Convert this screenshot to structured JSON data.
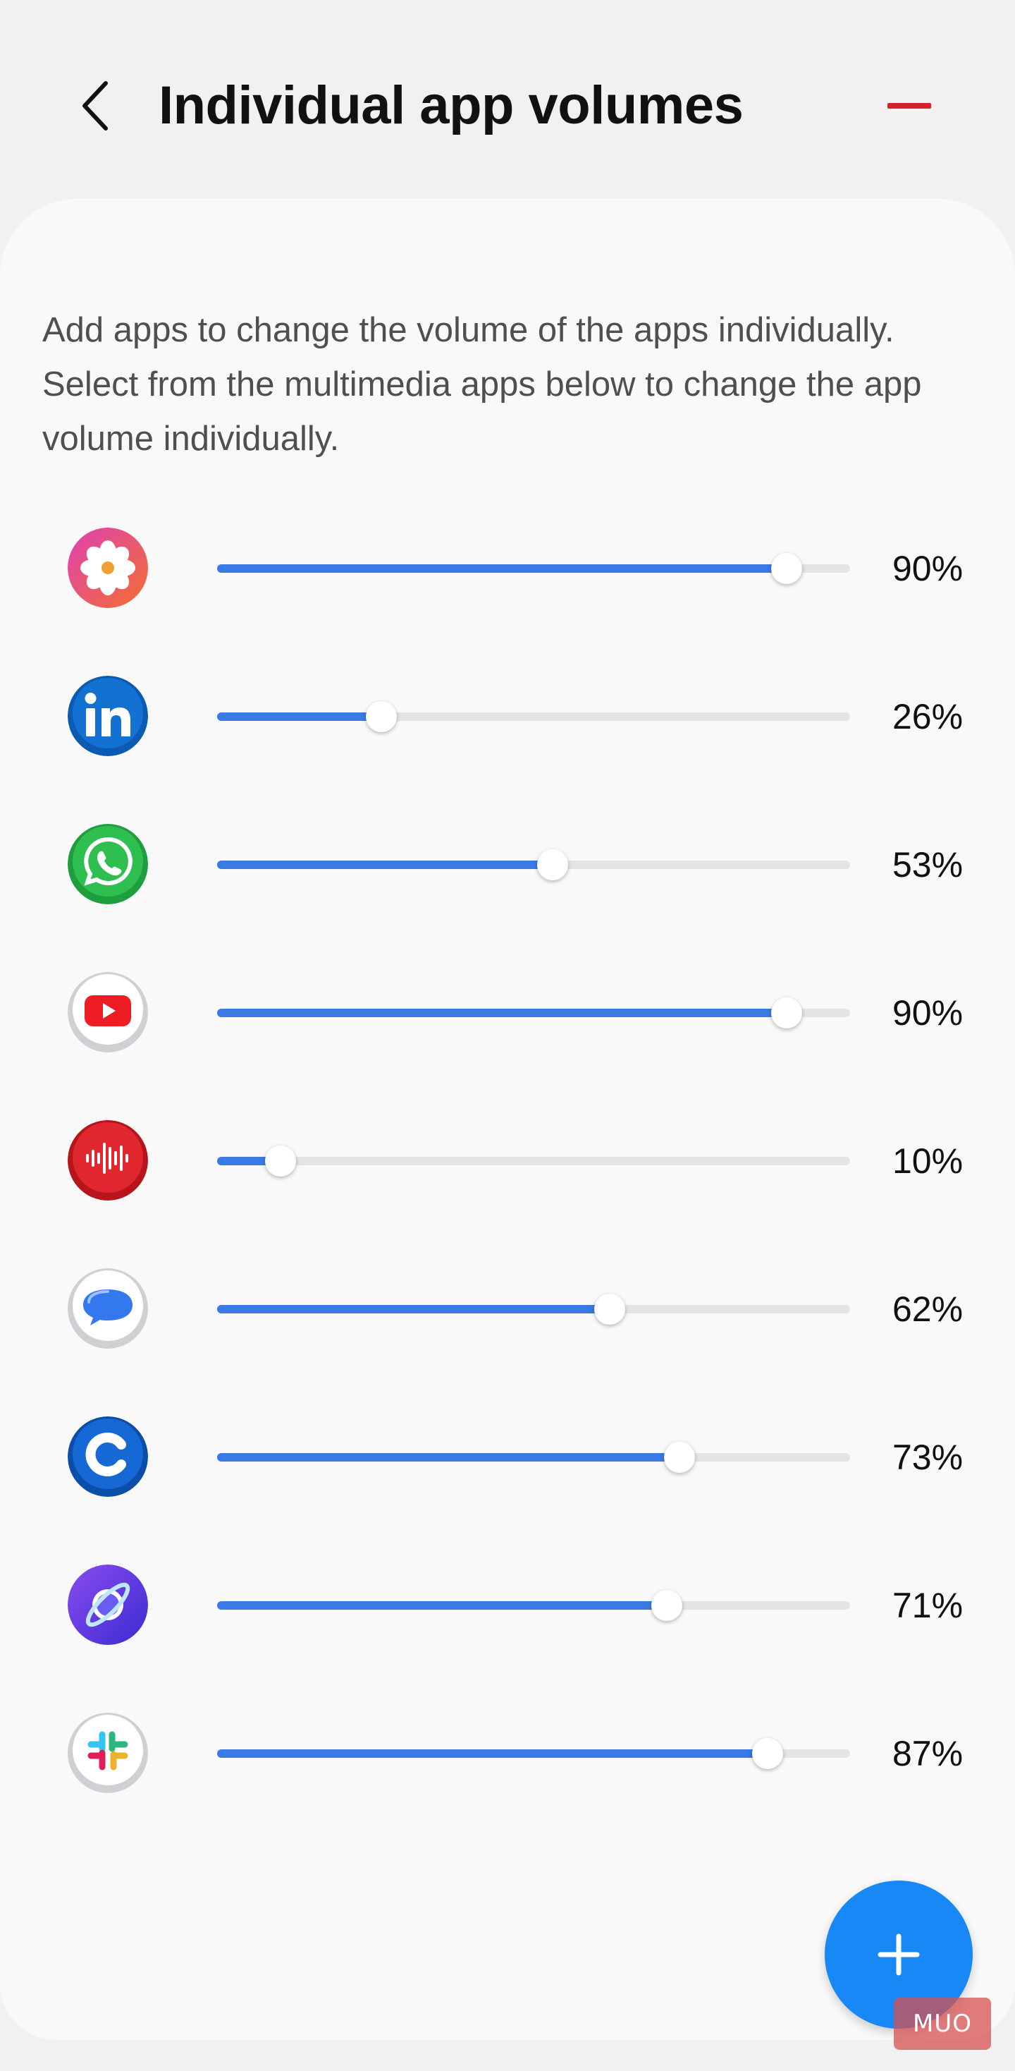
{
  "header": {
    "title": "Individual app volumes"
  },
  "description": "Add apps to change the volume of the apps individually. Select from the multimedia apps below to change the app volume individually.",
  "apps": [
    {
      "icon": "gallery-icon",
      "volume_percent": 90,
      "value_label": "90%"
    },
    {
      "icon": "linkedin-icon",
      "volume_percent": 26,
      "value_label": "26%"
    },
    {
      "icon": "whatsapp-icon",
      "volume_percent": 53,
      "value_label": "53%"
    },
    {
      "icon": "youtube-icon",
      "volume_percent": 90,
      "value_label": "90%"
    },
    {
      "icon": "voice-recorder-icon",
      "volume_percent": 10,
      "value_label": "10%"
    },
    {
      "icon": "messages-icon",
      "volume_percent": 62,
      "value_label": "62%"
    },
    {
      "icon": "c-app-icon",
      "volume_percent": 73,
      "value_label": "73%"
    },
    {
      "icon": "internet-browser-icon",
      "volume_percent": 71,
      "value_label": "71%"
    },
    {
      "icon": "slack-icon",
      "volume_percent": 87,
      "value_label": "87%"
    }
  ],
  "watermark": "MUO",
  "colors": {
    "accent": "#3a7ae4",
    "fab": "#1788f5",
    "remove": "#d8202a"
  }
}
